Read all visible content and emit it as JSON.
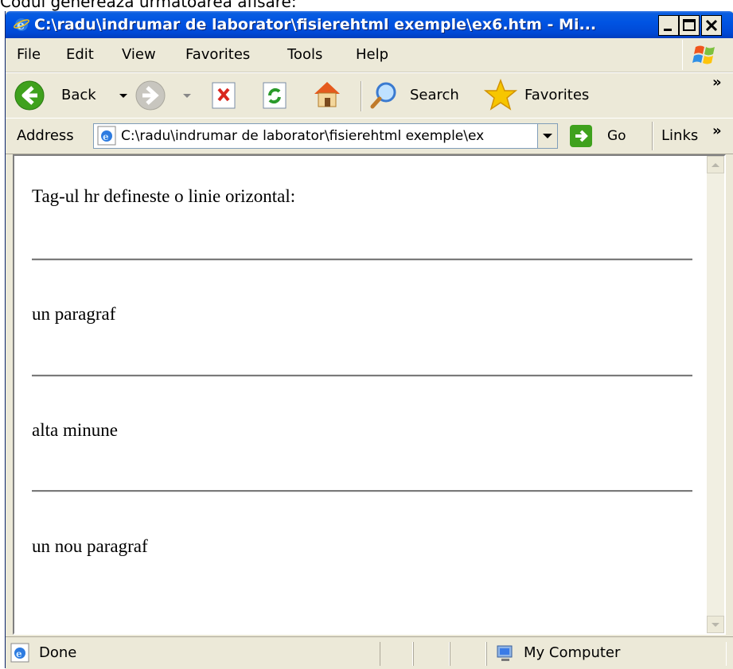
{
  "document_caption": "Codul genereaza urmatoarea afisare:",
  "window": {
    "title": "C:\\radu\\indrumar de laborator\\fisierehtml exemple\\ex6.htm - Mi...",
    "controls": [
      "minimize-icon",
      "maximize-icon",
      "close-icon"
    ]
  },
  "menu": {
    "items": [
      {
        "label": "File"
      },
      {
        "label": "Edit"
      },
      {
        "label": "View"
      },
      {
        "label": "Favorites"
      },
      {
        "label": "Tools"
      },
      {
        "label": "Help"
      }
    ]
  },
  "toolbar": {
    "back_label": "Back",
    "search_label": "Search",
    "favorites_label": "Favorites",
    "more_label": "»"
  },
  "address": {
    "label": "Address",
    "value": "C:\\radu\\indrumar de laborator\\fisierehtml exemple\\ex",
    "go_label": "Go",
    "links_label": "Links",
    "more_label": "»"
  },
  "content": {
    "lines": [
      "Tag-ul hr defineste o linie orizontal:",
      "un paragraf",
      "alta minune",
      "un nou paragraf"
    ]
  },
  "status": {
    "text": "Done",
    "zone": "My Computer"
  },
  "colors": {
    "title_bar": "#0054e3",
    "chrome": "#ece9d8",
    "back_green": "#3fa11d",
    "stop_red": "#d9251d",
    "favorites_star": "#f7c600"
  }
}
